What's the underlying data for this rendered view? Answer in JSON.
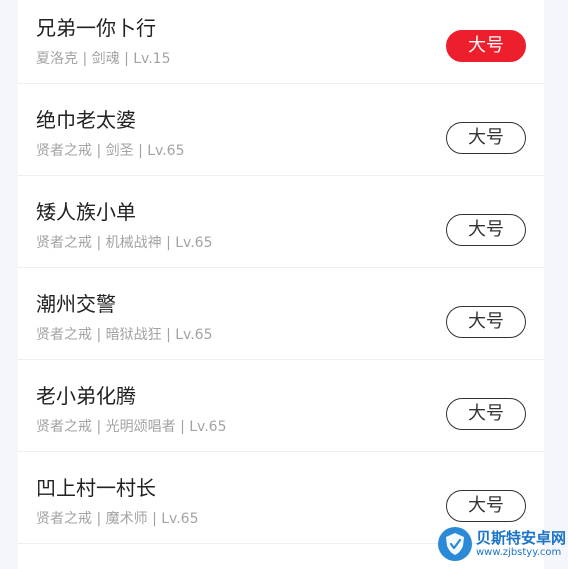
{
  "list": {
    "items": [
      {
        "name": "兄弟一你卜行",
        "meta": "夏洛克 | 剑魂 | Lv.15",
        "button": "大号",
        "active": true
      },
      {
        "name": "绝巾老太婆",
        "meta": "贤者之戒 | 剑圣 | Lv.65",
        "button": "大号",
        "active": false
      },
      {
        "name": "矮人族小单",
        "meta": "贤者之戒 | 机械战神 | Lv.65",
        "button": "大号",
        "active": false
      },
      {
        "name": "潮州交警",
        "meta": "贤者之戒 | 暗狱战狂 | Lv.65",
        "button": "大号",
        "active": false
      },
      {
        "name": "老小弟化腾",
        "meta": "贤者之戒 | 光明颂唱者 | Lv.65",
        "button": "大号",
        "active": false
      },
      {
        "name": "凹上村一村长",
        "meta": "贤者之戒 | 魔术师 | Lv.65",
        "button": "大号",
        "active": false
      }
    ]
  },
  "colors": {
    "accent": "#ee1f2c",
    "button_border": "#333333",
    "meta_text": "#a3a3a3"
  },
  "watermark": {
    "title": "贝斯特安卓网",
    "url": "www.zjbstyy.com",
    "icon": "shield-logo-icon"
  }
}
